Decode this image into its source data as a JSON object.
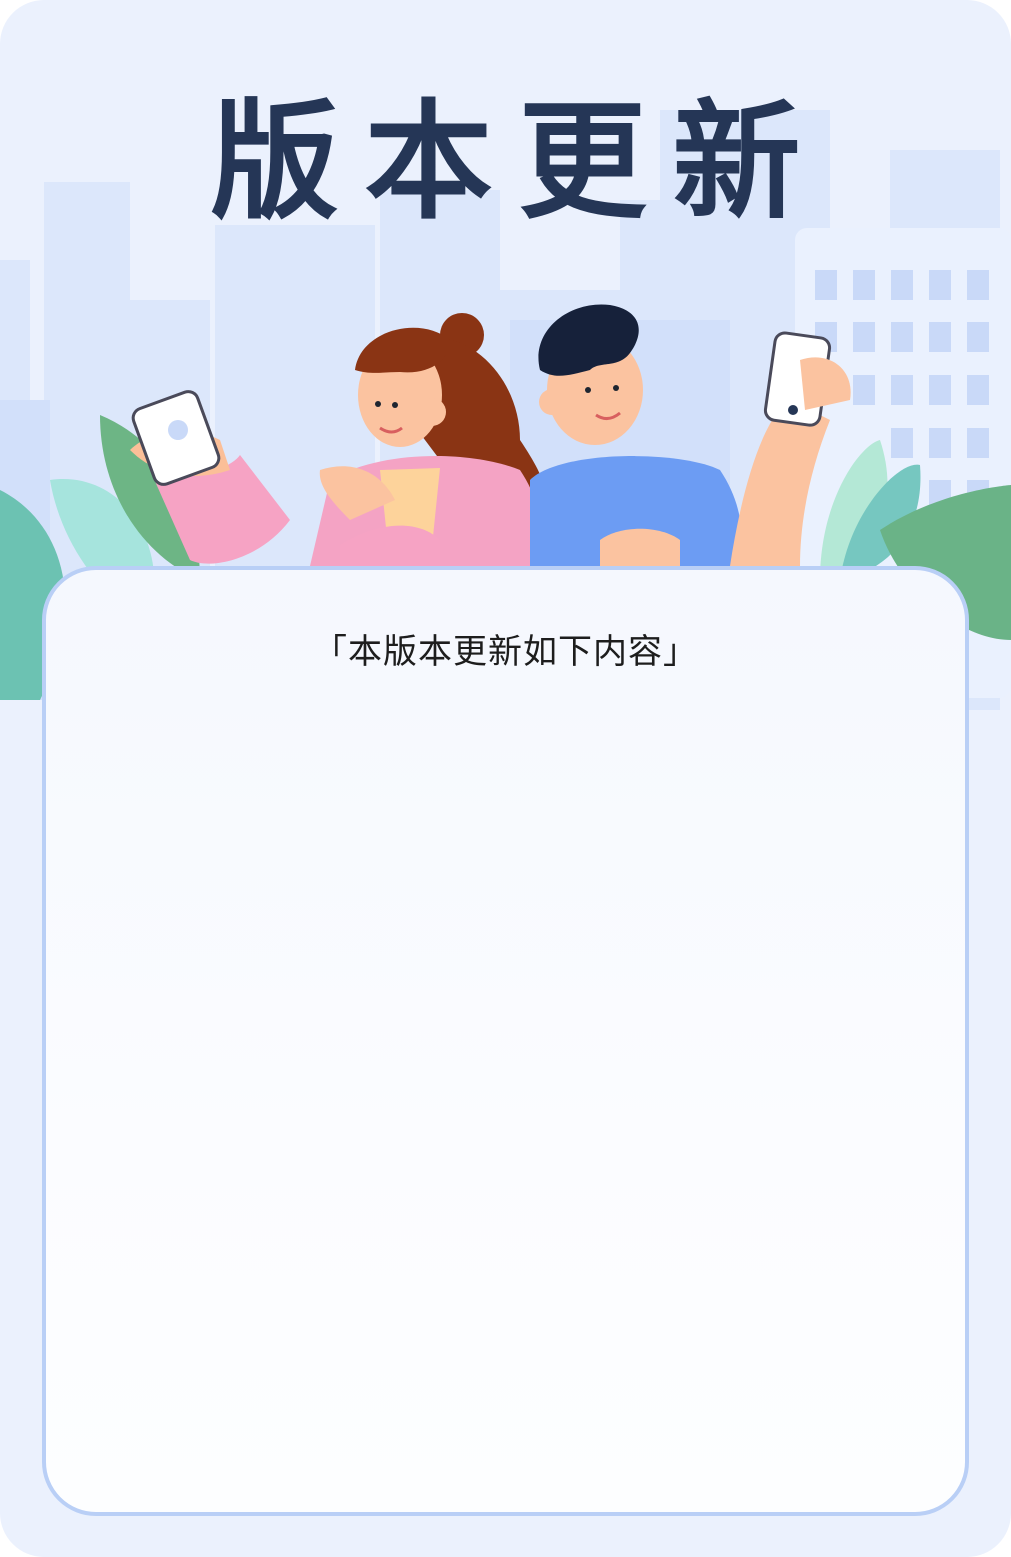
{
  "header": {
    "title": "版本更新"
  },
  "panel": {
    "subtitle": "「本版本更新如下内容」"
  },
  "colors": {
    "background": "#ebf1fd",
    "title": "#253656",
    "panel_border": "#b9cff6",
    "panel_fill": "#f7f9fe"
  },
  "icons": [
    "city-skyline",
    "woman-with-phone",
    "man-with-phone",
    "leaf-plant"
  ]
}
